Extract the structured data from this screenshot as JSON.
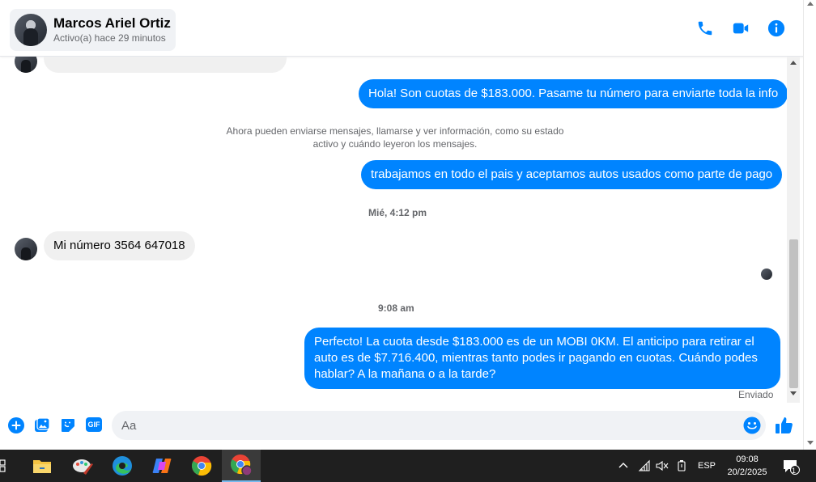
{
  "contact": {
    "name": "Marcos Ariel Ortiz",
    "status": "Activo(a) hace 29 minutos"
  },
  "header_icons": [
    "phone-icon",
    "video-camera-icon",
    "info-icon"
  ],
  "messages": {
    "out1": "Hola! Son cuotas de $183.000. Pasame tu número para enviarte toda la info",
    "system_line1": "Ahora pueden enviarse mensajes, llamarse y ver información, como su estado",
    "system_line2": "activo y cuándo leyeron los mensajes.",
    "out2": "trabajamos en todo el pais y aceptamos autos usados como parte de pago",
    "time1": "Mié, 4:12 pm",
    "in1": "Mi número 3564 647018",
    "time2": "9:08 am",
    "out3_line1": "Perfecto! La cuota desde $183.000 es de un MOBI 0KM. El anticipo para retirar el",
    "out3_line2": "auto es de $7.716.400, mientras tanto podes ir pagando en cuotas. Cuándo podes",
    "out3_line3": "hablar? A la mañana o a la tarde?",
    "sent_label": "Enviado"
  },
  "composer": {
    "placeholder": "Aa",
    "icons": [
      "plus-icon",
      "photo-icon",
      "sticker-icon",
      "gif-icon",
      "emoji-icon",
      "thumbs-up-icon"
    ],
    "gif_label": "GIF"
  },
  "taskbar": {
    "apps": [
      "file-explorer-icon",
      "paint-icon",
      "edge-icon",
      "copilot-icon",
      "chrome-icon",
      "chrome-profile-icon"
    ],
    "language": "ESP",
    "time": "09:08",
    "date": "20/2/2025",
    "notification_count": "1"
  },
  "colors": {
    "messenger_blue": "#0084ff",
    "incoming_bubble": "#f0f0f0",
    "taskbar": "#1f1f1f"
  }
}
